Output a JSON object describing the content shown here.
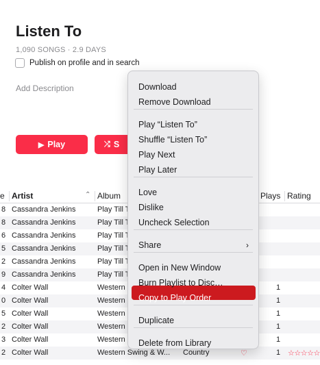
{
  "playlist": {
    "title": "Listen To",
    "subtitle": "1,090 SONGS · 2.9 DAYS",
    "publish_label": "Publish on profile and in search",
    "description_placeholder": "Add Description",
    "play_label": "Play",
    "shuffle_label": "S",
    "play_icon": "play-icon",
    "shuffle_icon": "shuffle-icon"
  },
  "table": {
    "columns": [
      "e",
      "Artist",
      "Album",
      "Plays",
      "Rating"
    ],
    "sort_column": "Artist",
    "sort_direction": "ascending",
    "rows": [
      {
        "idx": "8",
        "artist": "Cassandra Jenkins",
        "album": "Play Till T",
        "genre": "",
        "heart": "",
        "plays": "",
        "rating": ""
      },
      {
        "idx": "8",
        "artist": "Cassandra Jenkins",
        "album": "Play Till T",
        "genre": "",
        "heart": "",
        "plays": "",
        "rating": ""
      },
      {
        "idx": "6",
        "artist": "Cassandra Jenkins",
        "album": "Play Till T",
        "genre": "",
        "heart": "",
        "plays": "",
        "rating": ""
      },
      {
        "idx": "5",
        "artist": "Cassandra Jenkins",
        "album": "Play Till T",
        "genre": "",
        "heart": "",
        "plays": "",
        "rating": ""
      },
      {
        "idx": "2",
        "artist": "Cassandra Jenkins",
        "album": "Play Till T",
        "genre": "",
        "heart": "",
        "plays": "",
        "rating": ""
      },
      {
        "idx": "9",
        "artist": "Cassandra Jenkins",
        "album": "Play Till T",
        "genre": "",
        "heart": "",
        "plays": "",
        "rating": ""
      },
      {
        "idx": "4",
        "artist": "Colter Wall",
        "album": "Western",
        "genre": "",
        "heart": "",
        "plays": "1",
        "rating": ""
      },
      {
        "idx": "0",
        "artist": "Colter Wall",
        "album": "Western",
        "genre": "",
        "heart": "",
        "plays": "1",
        "rating": ""
      },
      {
        "idx": "5",
        "artist": "Colter Wall",
        "album": "Western",
        "genre": "",
        "heart": "",
        "plays": "1",
        "rating": ""
      },
      {
        "idx": "2",
        "artist": "Colter Wall",
        "album": "Western",
        "genre": "",
        "heart": "",
        "plays": "1",
        "rating": ""
      },
      {
        "idx": "3",
        "artist": "Colter Wall",
        "album": "Western",
        "genre": "",
        "heart": "",
        "plays": "1",
        "rating": ""
      },
      {
        "idx": "2",
        "artist": "Colter Wall",
        "album": "Western Swing & W...",
        "genre": "Country",
        "heart": "♡",
        "plays": "1",
        "rating": "☆☆☆☆☆"
      }
    ]
  },
  "context_menu": {
    "groups": [
      [
        "Download",
        "Remove Download"
      ],
      [
        "Play “Listen To”",
        "Shuffle “Listen To”",
        "Play Next",
        "Play Later"
      ],
      [
        "Love",
        "Dislike",
        "Uncheck Selection"
      ],
      [
        "Share"
      ],
      [
        "Open in New Window",
        "Burn Playlist to Disc…",
        "Copy to Play Order"
      ],
      [
        "Duplicate"
      ],
      [
        "Delete from Library"
      ]
    ],
    "highlighted": "Copy to Play Order",
    "submenu_item": "Share"
  },
  "colors": {
    "accent": "#fa2d48",
    "menu_highlight": "#cc1a1f",
    "secondary_text": "#8a8a8e"
  }
}
